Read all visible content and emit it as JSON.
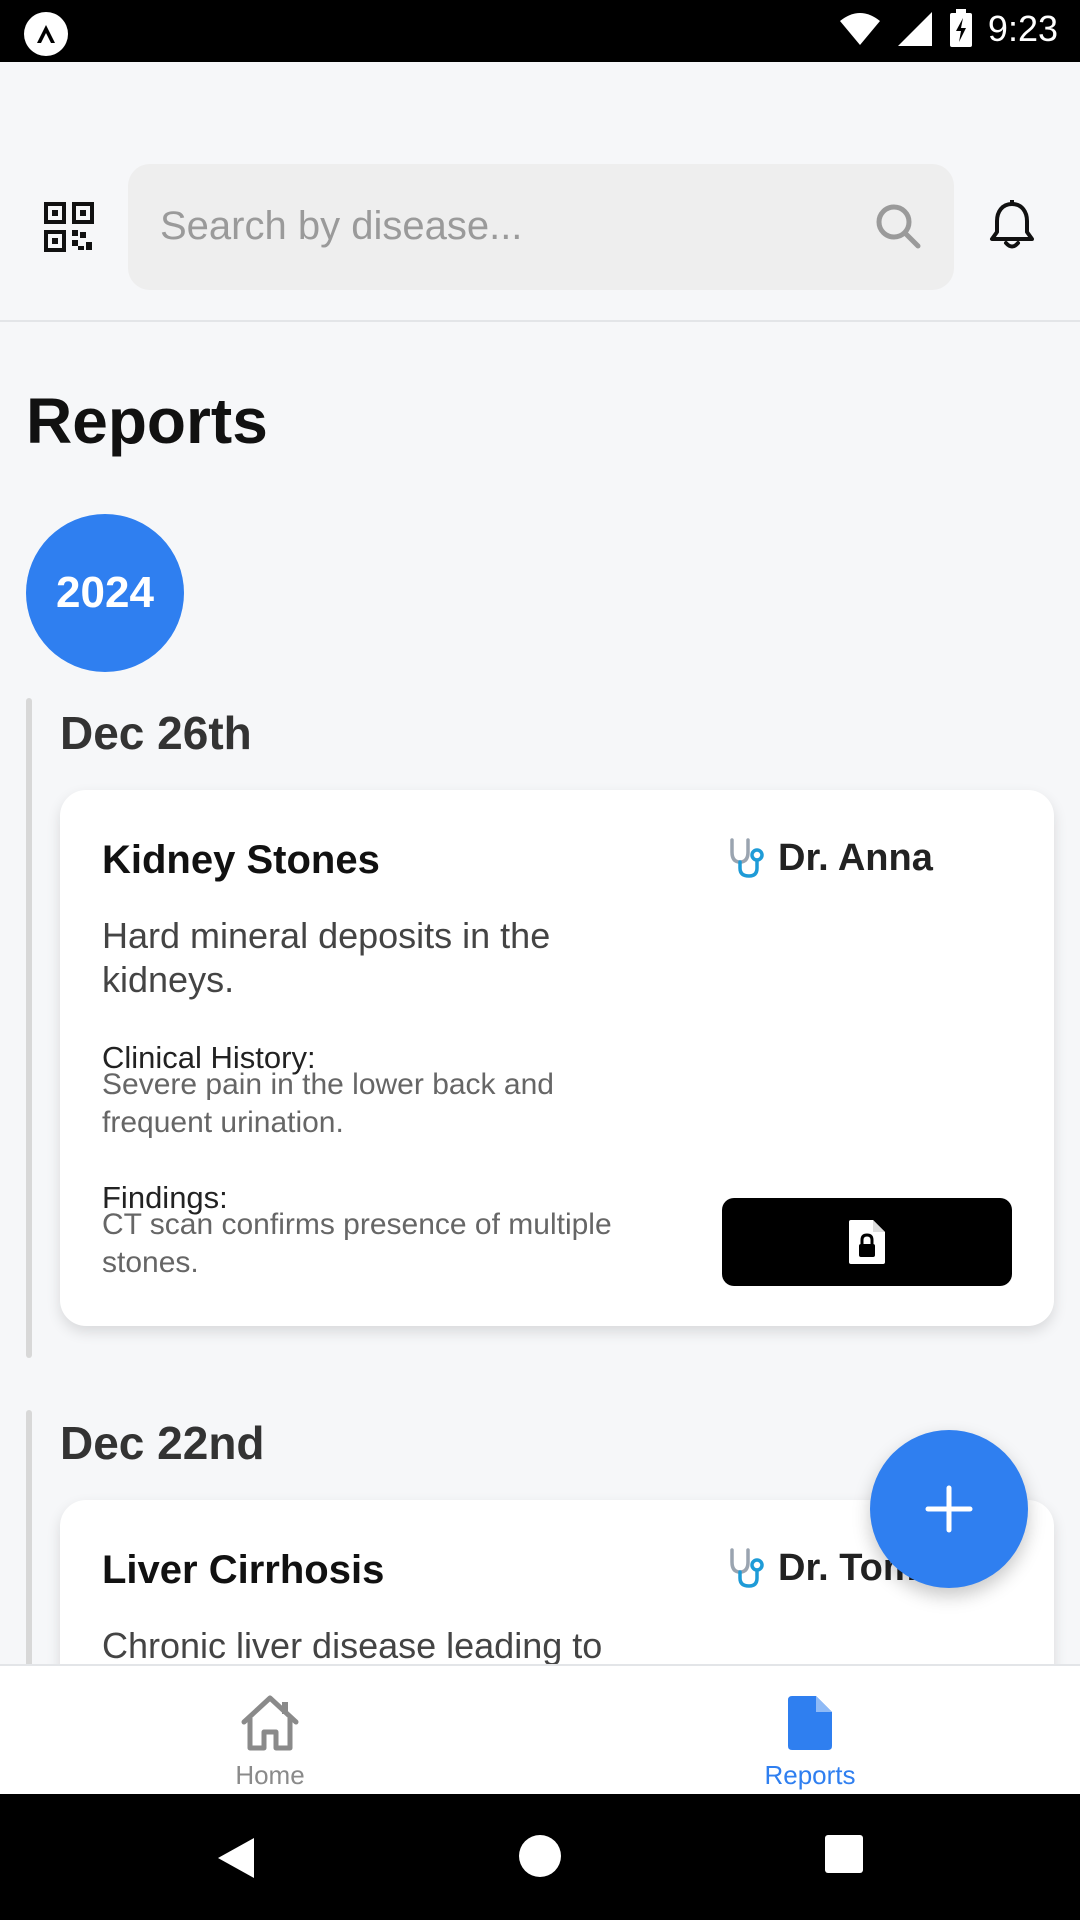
{
  "status_bar": {
    "time": "9:23"
  },
  "header": {
    "search": {
      "placeholder": "Search by disease..."
    }
  },
  "page": {
    "title": "Reports"
  },
  "timeline": {
    "year": "2024",
    "entries": [
      {
        "date": "Dec 26th",
        "title": "Kidney Stones",
        "doctor": "Dr. Anna",
        "description": "Hard mineral deposits in the kidneys.",
        "history_label": "Clinical History:",
        "history": "Severe pain in the lower back and frequent urination.",
        "findings_label": "Findings:",
        "findings": "CT scan confirms presence of multiple stones."
      },
      {
        "date": "Dec 22nd",
        "title": "Liver Cirrhosis",
        "doctor": "Dr. Tom",
        "description": "Chronic liver disease leading to"
      }
    ]
  },
  "bottom_nav": {
    "items": [
      {
        "label": "Home",
        "active": false
      },
      {
        "label": "Reports",
        "active": true
      }
    ]
  },
  "colors": {
    "accent": "#2f7ff0",
    "background": "#f6f7f9"
  }
}
